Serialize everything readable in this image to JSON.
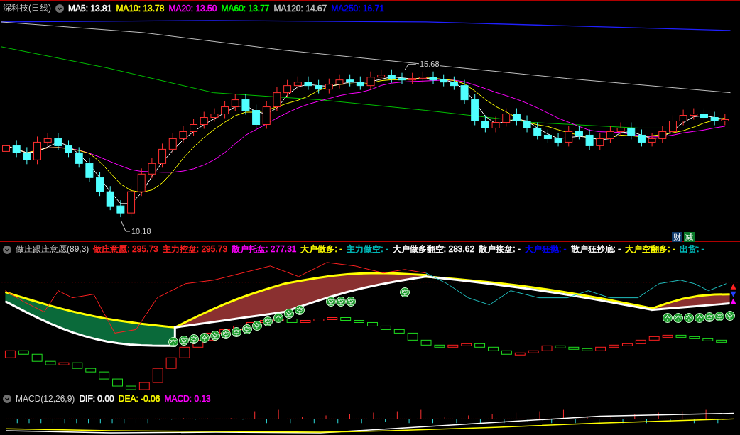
{
  "main_panel": {
    "title": "深科技(日线)",
    "indicators": [
      {
        "label": "MA5: 13.81",
        "color": "#ffffff"
      },
      {
        "label": "MA10: 13.78",
        "color": "#ffff00"
      },
      {
        "label": "MA20: 13.50",
        "color": "#ff00ff"
      },
      {
        "label": "MA60: 13.77",
        "color": "#00ff00"
      },
      {
        "label": "MA120: 14.67",
        "color": "#c0c0c0"
      },
      {
        "label": "MA250: 16.71",
        "color": "#0000ff"
      }
    ],
    "high_label": "15.68",
    "low_label": "10.18",
    "badges": [
      {
        "label": "财",
        "color": "#103a6a"
      },
      {
        "label": "减",
        "color": "#0a7a2a"
      }
    ]
  },
  "indicator_panel": {
    "title": "做庄跟庄意愿(89,3)",
    "values": [
      {
        "label": "做庄意愿: 295.73",
        "color": "#ff2020"
      },
      {
        "label": "主力控盘: 295.73",
        "color": "#ff2020"
      },
      {
        "label": "散户托盘: 277.31",
        "color": "#ff00ff"
      },
      {
        "label": "大户做多: -",
        "color": "#ffff00"
      },
      {
        "label": "主力做空: -",
        "color": "#00c0c0"
      },
      {
        "label": "大户做多翻空: 283.62",
        "color": "#ffffff"
      },
      {
        "label": "散户接盘: -",
        "color": "#ffffff"
      },
      {
        "label": "大户狂抛: -",
        "color": "#0000ff"
      },
      {
        "label": "散户狂抄底: -",
        "color": "#ffffff"
      },
      {
        "label": "大户空翻多: -",
        "color": "#ffff00"
      },
      {
        "label": "出货: -",
        "color": "#00c0c0"
      }
    ],
    "signal_markers": [
      "空",
      "空",
      "空",
      "空",
      "空",
      "空",
      "空",
      "空",
      "空",
      "空",
      "空",
      "空",
      "空",
      "空",
      "空",
      "空",
      "空",
      "空",
      "空",
      "空",
      "空",
      "空",
      "空",
      "空"
    ]
  },
  "macd_panel": {
    "title": "MACD(12,26,9)",
    "values": [
      {
        "label": "DIF: 0.00",
        "color": "#ffffff"
      },
      {
        "label": "DEA: -0.06",
        "color": "#ffff00"
      },
      {
        "label": "MACD: 0.13",
        "color": "#ff00ff"
      }
    ]
  }
}
